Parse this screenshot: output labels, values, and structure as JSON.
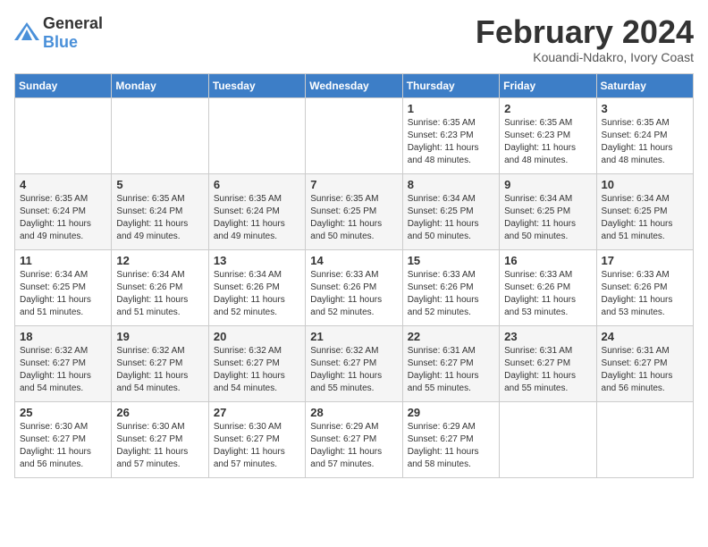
{
  "header": {
    "logo": {
      "general": "General",
      "blue": "Blue"
    },
    "title": "February 2024",
    "location": "Kouandi-Ndakro, Ivory Coast"
  },
  "days_of_week": [
    "Sunday",
    "Monday",
    "Tuesday",
    "Wednesday",
    "Thursday",
    "Friday",
    "Saturday"
  ],
  "weeks": [
    [
      {
        "day": "",
        "info": ""
      },
      {
        "day": "",
        "info": ""
      },
      {
        "day": "",
        "info": ""
      },
      {
        "day": "",
        "info": ""
      },
      {
        "day": "1",
        "info": "Sunrise: 6:35 AM\nSunset: 6:23 PM\nDaylight: 11 hours\nand 48 minutes."
      },
      {
        "day": "2",
        "info": "Sunrise: 6:35 AM\nSunset: 6:23 PM\nDaylight: 11 hours\nand 48 minutes."
      },
      {
        "day": "3",
        "info": "Sunrise: 6:35 AM\nSunset: 6:24 PM\nDaylight: 11 hours\nand 48 minutes."
      }
    ],
    [
      {
        "day": "4",
        "info": "Sunrise: 6:35 AM\nSunset: 6:24 PM\nDaylight: 11 hours\nand 49 minutes."
      },
      {
        "day": "5",
        "info": "Sunrise: 6:35 AM\nSunset: 6:24 PM\nDaylight: 11 hours\nand 49 minutes."
      },
      {
        "day": "6",
        "info": "Sunrise: 6:35 AM\nSunset: 6:24 PM\nDaylight: 11 hours\nand 49 minutes."
      },
      {
        "day": "7",
        "info": "Sunrise: 6:35 AM\nSunset: 6:25 PM\nDaylight: 11 hours\nand 50 minutes."
      },
      {
        "day": "8",
        "info": "Sunrise: 6:34 AM\nSunset: 6:25 PM\nDaylight: 11 hours\nand 50 minutes."
      },
      {
        "day": "9",
        "info": "Sunrise: 6:34 AM\nSunset: 6:25 PM\nDaylight: 11 hours\nand 50 minutes."
      },
      {
        "day": "10",
        "info": "Sunrise: 6:34 AM\nSunset: 6:25 PM\nDaylight: 11 hours\nand 51 minutes."
      }
    ],
    [
      {
        "day": "11",
        "info": "Sunrise: 6:34 AM\nSunset: 6:25 PM\nDaylight: 11 hours\nand 51 minutes."
      },
      {
        "day": "12",
        "info": "Sunrise: 6:34 AM\nSunset: 6:26 PM\nDaylight: 11 hours\nand 51 minutes."
      },
      {
        "day": "13",
        "info": "Sunrise: 6:34 AM\nSunset: 6:26 PM\nDaylight: 11 hours\nand 52 minutes."
      },
      {
        "day": "14",
        "info": "Sunrise: 6:33 AM\nSunset: 6:26 PM\nDaylight: 11 hours\nand 52 minutes."
      },
      {
        "day": "15",
        "info": "Sunrise: 6:33 AM\nSunset: 6:26 PM\nDaylight: 11 hours\nand 52 minutes."
      },
      {
        "day": "16",
        "info": "Sunrise: 6:33 AM\nSunset: 6:26 PM\nDaylight: 11 hours\nand 53 minutes."
      },
      {
        "day": "17",
        "info": "Sunrise: 6:33 AM\nSunset: 6:26 PM\nDaylight: 11 hours\nand 53 minutes."
      }
    ],
    [
      {
        "day": "18",
        "info": "Sunrise: 6:32 AM\nSunset: 6:27 PM\nDaylight: 11 hours\nand 54 minutes."
      },
      {
        "day": "19",
        "info": "Sunrise: 6:32 AM\nSunset: 6:27 PM\nDaylight: 11 hours\nand 54 minutes."
      },
      {
        "day": "20",
        "info": "Sunrise: 6:32 AM\nSunset: 6:27 PM\nDaylight: 11 hours\nand 54 minutes."
      },
      {
        "day": "21",
        "info": "Sunrise: 6:32 AM\nSunset: 6:27 PM\nDaylight: 11 hours\nand 55 minutes."
      },
      {
        "day": "22",
        "info": "Sunrise: 6:31 AM\nSunset: 6:27 PM\nDaylight: 11 hours\nand 55 minutes."
      },
      {
        "day": "23",
        "info": "Sunrise: 6:31 AM\nSunset: 6:27 PM\nDaylight: 11 hours\nand 55 minutes."
      },
      {
        "day": "24",
        "info": "Sunrise: 6:31 AM\nSunset: 6:27 PM\nDaylight: 11 hours\nand 56 minutes."
      }
    ],
    [
      {
        "day": "25",
        "info": "Sunrise: 6:30 AM\nSunset: 6:27 PM\nDaylight: 11 hours\nand 56 minutes."
      },
      {
        "day": "26",
        "info": "Sunrise: 6:30 AM\nSunset: 6:27 PM\nDaylight: 11 hours\nand 57 minutes."
      },
      {
        "day": "27",
        "info": "Sunrise: 6:30 AM\nSunset: 6:27 PM\nDaylight: 11 hours\nand 57 minutes."
      },
      {
        "day": "28",
        "info": "Sunrise: 6:29 AM\nSunset: 6:27 PM\nDaylight: 11 hours\nand 57 minutes."
      },
      {
        "day": "29",
        "info": "Sunrise: 6:29 AM\nSunset: 6:27 PM\nDaylight: 11 hours\nand 58 minutes."
      },
      {
        "day": "",
        "info": ""
      },
      {
        "day": "",
        "info": ""
      }
    ]
  ]
}
